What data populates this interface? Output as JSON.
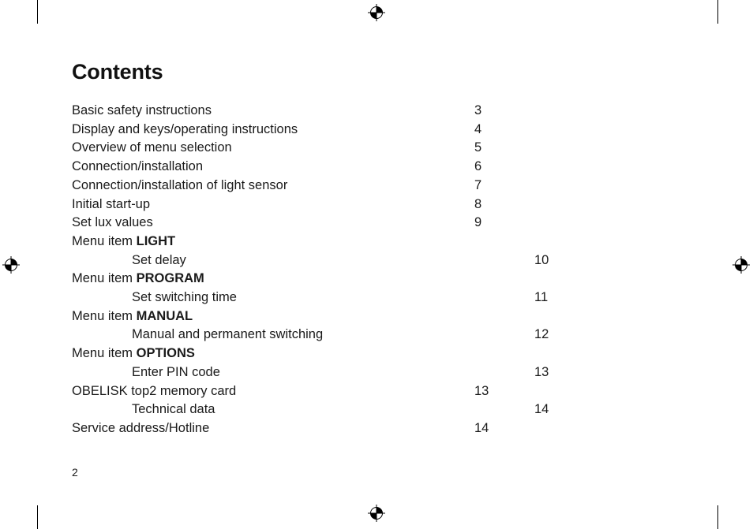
{
  "page": {
    "title": "Contents",
    "folio": "2",
    "toc": [
      {
        "label": "Basic safety instructions",
        "page": "3",
        "indent": false,
        "bold_tail": ""
      },
      {
        "label": "Display and keys/operating instructions",
        "page": "4",
        "indent": false,
        "bold_tail": ""
      },
      {
        "label": "Overview of menu selection",
        "page": "5",
        "indent": false,
        "bold_tail": ""
      },
      {
        "label": "Connection/installation",
        "page": "6",
        "indent": false,
        "bold_tail": ""
      },
      {
        "label": "Connection/installation of light sensor",
        "page": "7",
        "indent": false,
        "bold_tail": ""
      },
      {
        "label": "Initial start-up",
        "page": "8",
        "indent": false,
        "bold_tail": ""
      },
      {
        "label": "Set lux values",
        "page": "9",
        "indent": false,
        "bold_tail": ""
      },
      {
        "label": "Menu item ",
        "page": "",
        "indent": false,
        "bold_tail": "LIGHT"
      },
      {
        "label": "Set delay",
        "page": "10",
        "indent": true,
        "bold_tail": ""
      },
      {
        "label": "Menu item ",
        "page": "",
        "indent": false,
        "bold_tail": "PROGRAM"
      },
      {
        "label": "Set switching time",
        "page": "11",
        "indent": true,
        "bold_tail": ""
      },
      {
        "label": "Menu item ",
        "page": "",
        "indent": false,
        "bold_tail": "MANUAL"
      },
      {
        "label": "Manual and permanent switching",
        "page": "12",
        "indent": true,
        "bold_tail": ""
      },
      {
        "label": "Menu item ",
        "page": "",
        "indent": false,
        "bold_tail": "OPTIONS"
      },
      {
        "label": "Enter PIN code",
        "page": "13",
        "indent": true,
        "bold_tail": ""
      },
      {
        "label": "OBELISK top2 memory card",
        "page": "13",
        "indent": false,
        "bold_tail": ""
      },
      {
        "label": "Technical data",
        "page": "14",
        "indent": true,
        "bold_tail": ""
      },
      {
        "label": "Service address/Hotline",
        "page": "14",
        "indent": false,
        "bold_tail": ""
      }
    ]
  }
}
